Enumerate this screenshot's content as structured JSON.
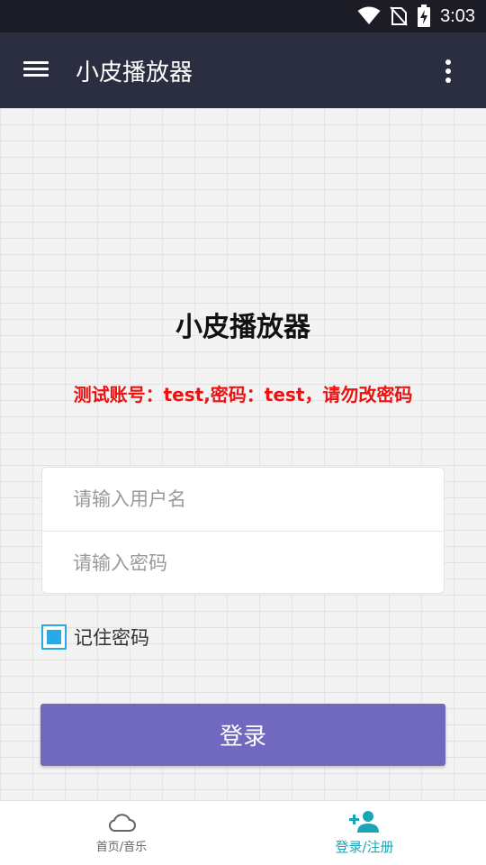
{
  "status_bar": {
    "time": "3:03",
    "icons": [
      "wifi-icon",
      "no-sim-icon",
      "battery-charging-icon"
    ]
  },
  "app_bar": {
    "title": "小皮播放器",
    "menu_icon": "hamburger-menu-icon",
    "more_icon": "more-vertical-icon"
  },
  "login": {
    "title": "小皮播放器",
    "hint": "测试账号：test,密码：test，请勿改密码",
    "username_placeholder": "请输入用户名",
    "username_value": "",
    "password_placeholder": "请输入密码",
    "password_value": "",
    "remember_label": "记住密码",
    "remember_checked": true,
    "login_button": "登录"
  },
  "bottom_nav": {
    "items": [
      {
        "label": "首页/音乐",
        "icon": "cloud-icon",
        "active": false
      },
      {
        "label": "登录/注册",
        "icon": "add-user-icon",
        "active": true
      }
    ]
  },
  "colors": {
    "status_bar": "#1b1c26",
    "app_bar": "#2b2d40",
    "hint": "#ee1111",
    "accent_button": "#7168bf",
    "checkbox": "#29a9e6",
    "active_tab": "#1aa5b5"
  }
}
